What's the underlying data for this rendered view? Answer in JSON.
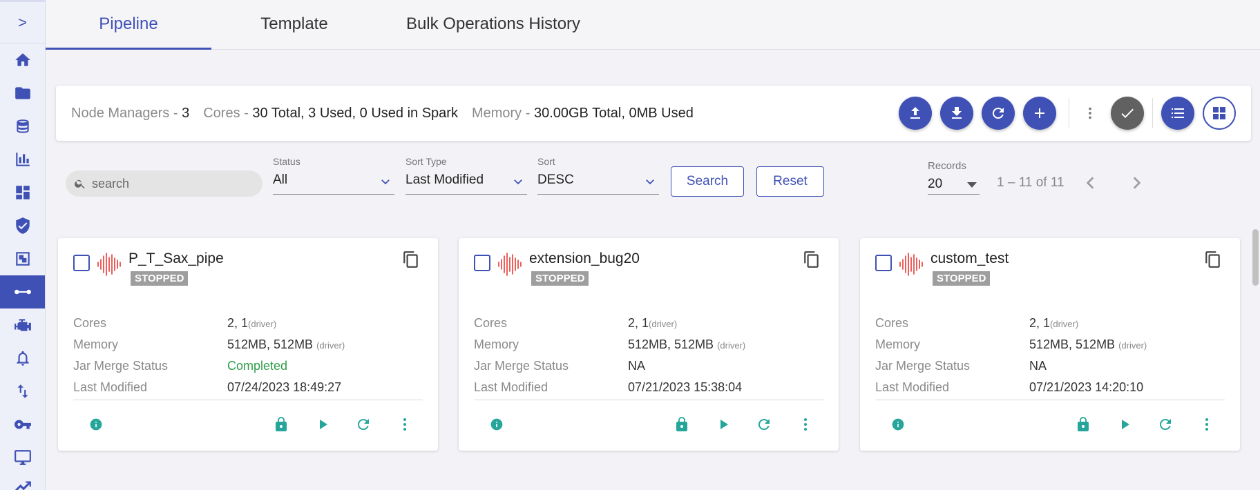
{
  "sidebar": {
    "expand_glyph": ">",
    "items": [
      {
        "icon": "home-icon"
      },
      {
        "icon": "folder-icon"
      },
      {
        "icon": "database-icon"
      },
      {
        "icon": "bar-chart-icon"
      },
      {
        "icon": "dashboard-icon"
      },
      {
        "icon": "shield-check-icon"
      },
      {
        "icon": "layers-icon"
      },
      {
        "icon": "pipeline-icon",
        "active": true
      },
      {
        "icon": "engine-icon"
      },
      {
        "icon": "bell-icon"
      },
      {
        "icon": "swap-vertical-icon"
      },
      {
        "icon": "key-icon"
      },
      {
        "icon": "monitor-icon"
      },
      {
        "icon": "chart-line-icon"
      }
    ]
  },
  "tabs": [
    {
      "label": "Pipeline",
      "active": true
    },
    {
      "label": "Template"
    },
    {
      "label": "Bulk Operations History"
    }
  ],
  "info": {
    "node_managers_label": "Node Managers -",
    "node_managers_value": "3",
    "cores_label": "Cores -",
    "cores_value": "30 Total, 3 Used, 0 Used in Spark",
    "memory_label": "Memory -",
    "memory_value": "30.00GB Total, 0MB Used"
  },
  "filters": {
    "search_placeholder": "search",
    "status_label": "Status",
    "status_value": "All",
    "sort_type_label": "Sort Type",
    "sort_type_value": "Last Modified",
    "sort_label": "Sort",
    "sort_value": "DESC",
    "search_button": "Search",
    "reset_button": "Reset",
    "records_label": "Records",
    "records_value": "20",
    "range_text": "1 – 11 of 11"
  },
  "cards": [
    {
      "name": "P_T_Sax_pipe",
      "status": "STOPPED",
      "cores_label": "Cores",
      "cores_value": "2, 1",
      "cores_suffix": "(driver)",
      "memory_label": "Memory",
      "memory_value": "512MB, 512MB",
      "memory_suffix": "(driver)",
      "jar_label": "Jar Merge Status",
      "jar_value": "Completed",
      "modified_label": "Last Modified",
      "modified_value": "07/24/2023 18:49:27"
    },
    {
      "name": "extension_bug20",
      "status": "STOPPED",
      "cores_label": "Cores",
      "cores_value": "2, 1",
      "cores_suffix": "(driver)",
      "memory_label": "Memory",
      "memory_value": "512MB, 512MB",
      "memory_suffix": "(driver)",
      "jar_label": "Jar Merge Status",
      "jar_value": "NA",
      "modified_label": "Last Modified",
      "modified_value": "07/21/2023 15:38:04"
    },
    {
      "name": "custom_test",
      "status": "STOPPED",
      "cores_label": "Cores",
      "cores_value": "2, 1",
      "cores_suffix": "(driver)",
      "memory_label": "Memory",
      "memory_value": "512MB, 512MB",
      "memory_suffix": "(driver)",
      "jar_label": "Jar Merge Status",
      "jar_value": "NA",
      "modified_label": "Last Modified",
      "modified_value": "07/21/2023 14:20:10"
    }
  ],
  "colors": {
    "primary": "#3f51b5",
    "accent_teal": "#26a69a",
    "status_green": "#2e9d4a",
    "badge_grey": "#9e9e9e",
    "wave_red": "#e53935"
  }
}
